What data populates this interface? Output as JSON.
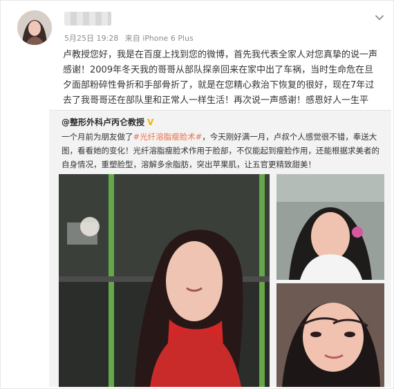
{
  "post": {
    "date": "5月25日 19:28",
    "source": "来自 iPhone 6 Plus",
    "text": "卢教授您好，我是在百度上找到您的微博，首先我代表全家人对您真挚的说一声感谢！2009年冬天我的哥哥从部队探亲回来在家中出了车祸，当时生命危在旦夕面部粉碎性骨折和手部骨折了，就是在您精心救治下恢复的很好，现在7年过去了我哥哥还在部队里和正常人一样生活！再次说一声感谢！感恩好人一生平安！"
  },
  "repost": {
    "author": "@整形外科卢丙仑教授",
    "text_pre": "一个月前为朋友做了",
    "hashtag": "#光纤溶脂瘦脸术#",
    "text_post": "，今天刚好满一月，卢叔个人感觉很不错，奉送大图，看看她的变化！光纤溶脂瘦脸术作用于脸部，不仅能起到瘦脸作用，还能根据求美者的自身情况，重塑脸型，溶解多余脂肪，突出苹果肌，让五官更精致甜美！"
  },
  "icons": {
    "avatar": "profile-photo",
    "menu": "chevron-down-icon",
    "verified": "verified-badge-icon"
  },
  "colors": {
    "hashtag": "#eb7350",
    "repost_bg": "#f3f3f3",
    "meta_text": "#8c8c8c",
    "verified": "#f0b400"
  }
}
